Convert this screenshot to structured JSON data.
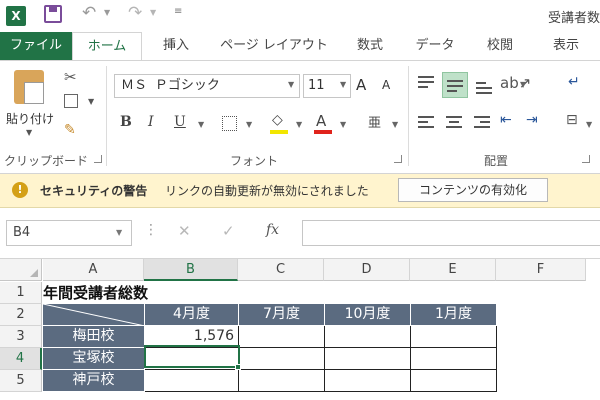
{
  "app": {
    "logo_text": "X",
    "document_title": "受講者数"
  },
  "ribbon_tabs": {
    "file": "ファイル",
    "home": "ホーム",
    "insert": "挿入",
    "page_layout": "ページ レイアウト",
    "formulas": "数式",
    "data": "データ",
    "review": "校閲",
    "view": "表示"
  },
  "clipboard": {
    "paste_label": "貼り付け",
    "group_label": "クリップボード"
  },
  "font": {
    "name": "ＭＳ Ｐゴシック",
    "size": "11",
    "group_label": "フォント",
    "bold": "B",
    "italic": "I",
    "underline": "U",
    "grow": "A",
    "shrink": "A",
    "font_color": "A",
    "phonetic": "亜"
  },
  "alignment": {
    "group_label": "配置"
  },
  "message_bar": {
    "title": "セキュリティの警告",
    "text": "リンクの自動更新が無効にされました",
    "button": "コンテンツの有効化"
  },
  "formula_bar": {
    "name_box": "B4",
    "fx": "fx",
    "formula": ""
  },
  "sheet": {
    "columns": [
      "A",
      "B",
      "C",
      "D",
      "E",
      "F"
    ],
    "rows": [
      "1",
      "2",
      "3",
      "4",
      "5"
    ],
    "selected_cell": "B4",
    "title": "年間受講者総数",
    "month_headers": [
      "4月度",
      "7月度",
      "10月度",
      "1月度"
    ],
    "schools": [
      "梅田校",
      "宝塚校",
      "神戸校"
    ],
    "values": {
      "umeda_april": "1,576"
    }
  },
  "colors": {
    "accent": "#217346",
    "table_header": "#5b6b80",
    "message_bar": "#fff4ce"
  }
}
